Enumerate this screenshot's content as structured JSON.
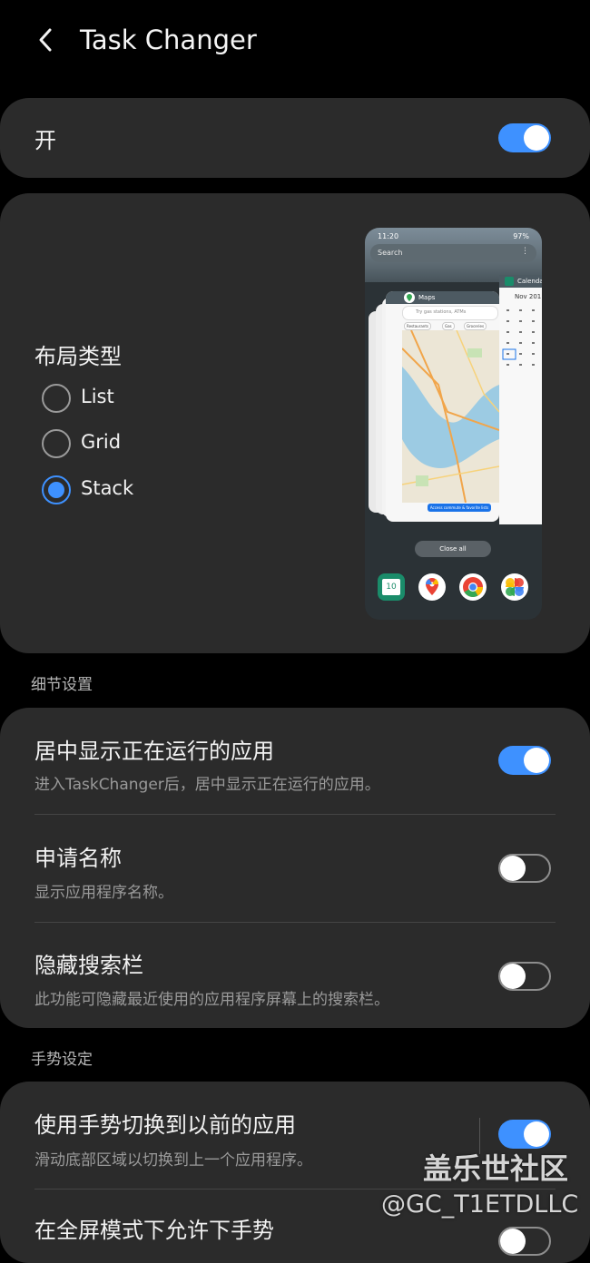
{
  "header": {
    "title": "Task Changer",
    "back_icon": "chevron-left-icon"
  },
  "master": {
    "label": "开",
    "enabled": true
  },
  "layout": {
    "title": "布局类型",
    "options": [
      {
        "label": "List",
        "selected": false
      },
      {
        "label": "Grid",
        "selected": false
      },
      {
        "label": "Stack",
        "selected": true
      }
    ],
    "preview": {
      "time": "11:20",
      "battery": "97%",
      "search_placeholder": "Search",
      "maps_label": "Maps",
      "maps_search": "Try gas stations, ATMs",
      "chips": [
        "Restaurants",
        "Gas",
        "Groceries"
      ],
      "banner": "Access commute & favorite lists",
      "calendar_label": "Calenda",
      "calendar_month": "Nov 201",
      "close_all": "Close all",
      "dock_badge": "10"
    }
  },
  "details": {
    "section_title": "细节设置",
    "items": [
      {
        "title": "居中显示正在运行的应用",
        "desc": "进入TaskChanger后，居中显示正在运行的应用。",
        "enabled": true
      },
      {
        "title": "申请名称",
        "desc": "显示应用程序名称。",
        "enabled": false
      },
      {
        "title": "隐藏搜索栏",
        "desc": "此功能可隐藏最近使用的应用程序屏幕上的搜索栏。",
        "enabled": false
      }
    ]
  },
  "gestures": {
    "section_title": "手势设定",
    "items": [
      {
        "title": "使用手势切换到以前的应用",
        "desc": "滑动底部区域以切换到上一个应用程序。",
        "enabled": true
      },
      {
        "title": "在全屏模式下允许下手势",
        "enabled": false
      }
    ]
  },
  "watermark": {
    "line1": "盖乐世社区",
    "line2": "@GC_T1ETDLLC"
  },
  "colors": {
    "accent": "#3e91ff",
    "card": "#2b2b2b",
    "background": "#000000"
  }
}
